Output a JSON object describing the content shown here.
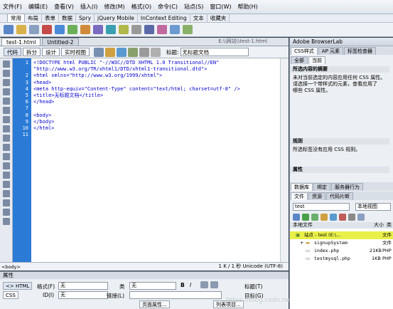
{
  "menu": [
    "文件(F)",
    "编辑(E)",
    "查看(V)",
    "插入(I)",
    "修改(M)",
    "格式(O)",
    "命令(C)",
    "站点(S)",
    "窗口(W)",
    "帮助(H)"
  ],
  "insert_tabs": [
    "常用",
    "布局",
    "表单",
    "数据",
    "Spry",
    "jQuery Mobile",
    "InContext Editing",
    "文本",
    "收藏夹"
  ],
  "doc_tabs": [
    "test-1.html",
    "Untitled-2"
  ],
  "file_path": "E:\\\\网站\\\\test-1.html",
  "view_buttons": [
    "代码",
    "拆分",
    "设计",
    "实时视图"
  ],
  "title_label": "标题:",
  "title_value": "无标题文档",
  "code_lines": [
    "<!DOCTYPE html PUBLIC \"-//W3C//DTD XHTML 1.0 Transitional//EN\"",
    "\"http://www.w3.org/TR/xhtml1/DTD/xhtml1-transitional.dtd\">",
    "<html xmlns=\"http://www.w3.org/1999/xhtml\">",
    "<head>",
    "<meta http-equiv=\"Content-Type\" content=\"text/html; charset=utf-8\" />",
    "<title>无标题文档</title>",
    "</head>",
    "",
    "<body>",
    "</body>",
    "</html>",
    ""
  ],
  "line_numbers": [
    "1",
    "",
    "2",
    "3",
    "4",
    "5",
    "6",
    "7",
    "8",
    "9",
    "10",
    "11"
  ],
  "status": {
    "tag": "<body>",
    "info": "1 K / 1 秒  Unicode (UTF-8)"
  },
  "properties": {
    "title": "属性",
    "html_btn": "<> HTML",
    "css_btn": "CSS",
    "format_label": "格式(F)",
    "format_value": "无",
    "id_label": "ID(I)",
    "id_value": "无",
    "class_label": "类",
    "class_value": "无",
    "link_label": "链接(L)",
    "title_label": "标题(T)",
    "target_label": "目标(G)",
    "page_props_btn": "页面属性...",
    "list_item_btn": "列表项目..."
  },
  "browserlab": {
    "title": "Adobe BrowserLab"
  },
  "css_tabs": [
    "CSS样式",
    "AP 元素",
    "标签检查器"
  ],
  "css_modes": [
    "全部",
    "当前"
  ],
  "selection_summary": {
    "heading": "所选内容的摘要",
    "text": [
      "未对当前选定的内容应用任何 CSS 属性。",
      "请选择一个带样式的元素，查看应用了",
      "哪些 CSS 属性。"
    ]
  },
  "rules": {
    "heading": "规则",
    "text": "所选标签没有应用 CSS 规则。"
  },
  "attributes_heading": "属性",
  "files_tabs1": [
    "数据库",
    "绑定",
    "服务器行为"
  ],
  "files_tabs2": [
    "文件",
    "资源",
    "代码片断"
  ],
  "site_select": "test",
  "view_select": "本地视图",
  "columns": {
    "local": "本地文件",
    "size": "大小",
    "type": "类型"
  },
  "tree": [
    {
      "name": "站点 - test (E:\\...",
      "size": "",
      "type": "文件"
    },
    {
      "name": "signupSystem",
      "size": "",
      "type": "文件"
    },
    {
      "name": "index.php",
      "size": "21KB",
      "type": "PHP"
    },
    {
      "name": "testmysql.php",
      "size": "1KB",
      "type": "PHP"
    }
  ],
  "watermark": "https://blog.csdn.net/qq_44474871",
  "colors": {
    "gutter": "#2b7bd6",
    "tree_highlight": "#e9f04a"
  }
}
